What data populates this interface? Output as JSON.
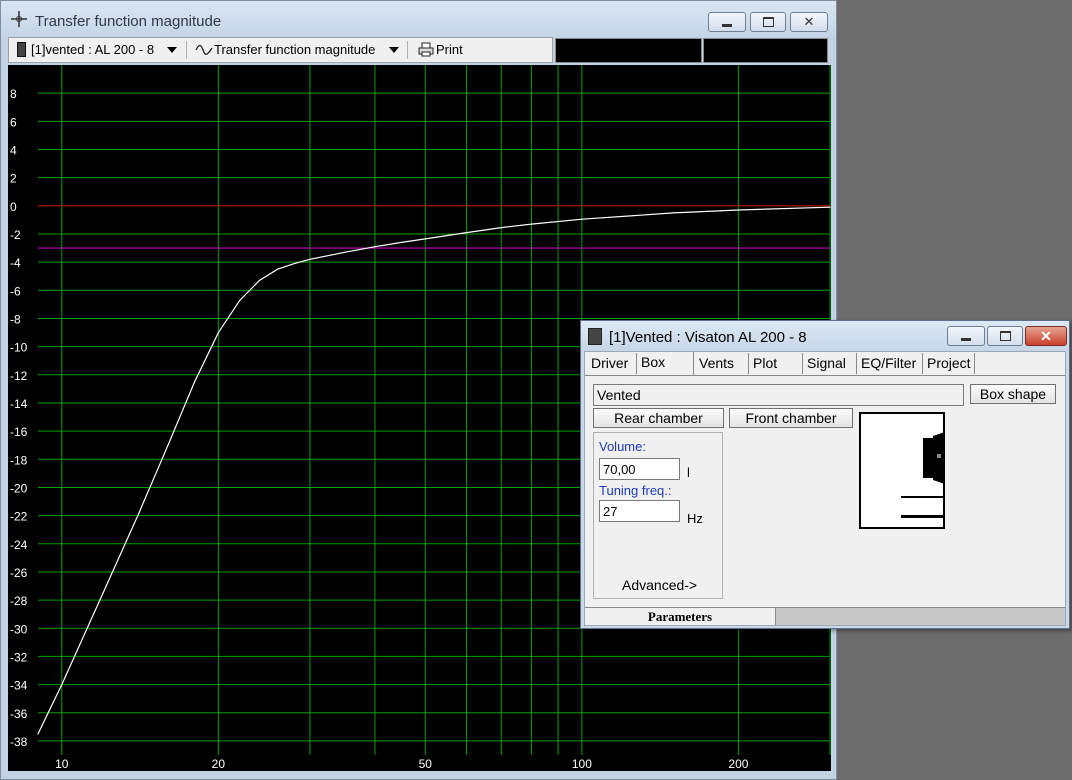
{
  "main_window": {
    "title": "Transfer function magnitude",
    "toolbar": {
      "driver_select": "[1]vented : AL 200 - 8",
      "plot_select": "Transfer function magnitude",
      "print_label": "Print"
    }
  },
  "colors": {
    "grid": "#00a000",
    "curve": "#ffffff",
    "zero_line": "#c00000",
    "ref_line": "#c000c0",
    "plot_bg": "#000000"
  },
  "chart_data": {
    "type": "line",
    "title": "",
    "xlabel": "",
    "ylabel": "",
    "x_scale": "log",
    "xlim": [
      9,
      300
    ],
    "ylim": [
      -39,
      10
    ],
    "x_tick_labels": [
      "10",
      "20",
      "50",
      "100",
      "200"
    ],
    "y_tick_labels": [
      "8",
      "6",
      "4",
      "2",
      "0",
      "-2",
      "-4",
      "-6",
      "-8",
      "-10",
      "-12",
      "-14",
      "-16",
      "-18",
      "-20",
      "-22",
      "-24",
      "-26",
      "-28",
      "-30",
      "-32",
      "-34",
      "-36",
      "-38"
    ],
    "grid": true,
    "reference_lines": [
      {
        "y": 0,
        "color": "#c00000"
      },
      {
        "y": -3,
        "color": "#c000c0"
      }
    ],
    "series": [
      {
        "x": [
          9,
          10,
          12,
          14,
          16,
          18,
          20,
          22,
          24,
          26,
          28,
          30,
          35,
          40,
          45,
          50,
          60,
          70,
          80,
          100,
          150,
          200,
          300
        ],
        "y": [
          -37.5,
          -34.0,
          -27.5,
          -22.0,
          -17.0,
          -12.5,
          -9.0,
          -6.7,
          -5.3,
          -4.5,
          -4.1,
          -3.8,
          -3.3,
          -2.9,
          -2.6,
          -2.35,
          -1.9,
          -1.55,
          -1.3,
          -0.95,
          -0.5,
          -0.3,
          -0.1
        ]
      }
    ]
  },
  "dialog": {
    "title": "[1]Vented : Visaton AL 200 - 8",
    "tabs": [
      "Driver",
      "Box",
      "Vents",
      "Plot",
      "Signal",
      "EQ/Filter",
      "Project"
    ],
    "active_tab": "Box",
    "box_type": "Vented",
    "box_shape_button": "Box shape",
    "rear_chamber_button": "Rear chamber",
    "front_chamber_button": "Front chamber",
    "volume_label": "Volume:",
    "volume_value": "70,00",
    "volume_unit": "l",
    "tuning_label": "Tuning freq.:",
    "tuning_value": "27",
    "tuning_unit": "Hz",
    "advanced_label": "Advanced->",
    "status_label": "Parameters"
  }
}
